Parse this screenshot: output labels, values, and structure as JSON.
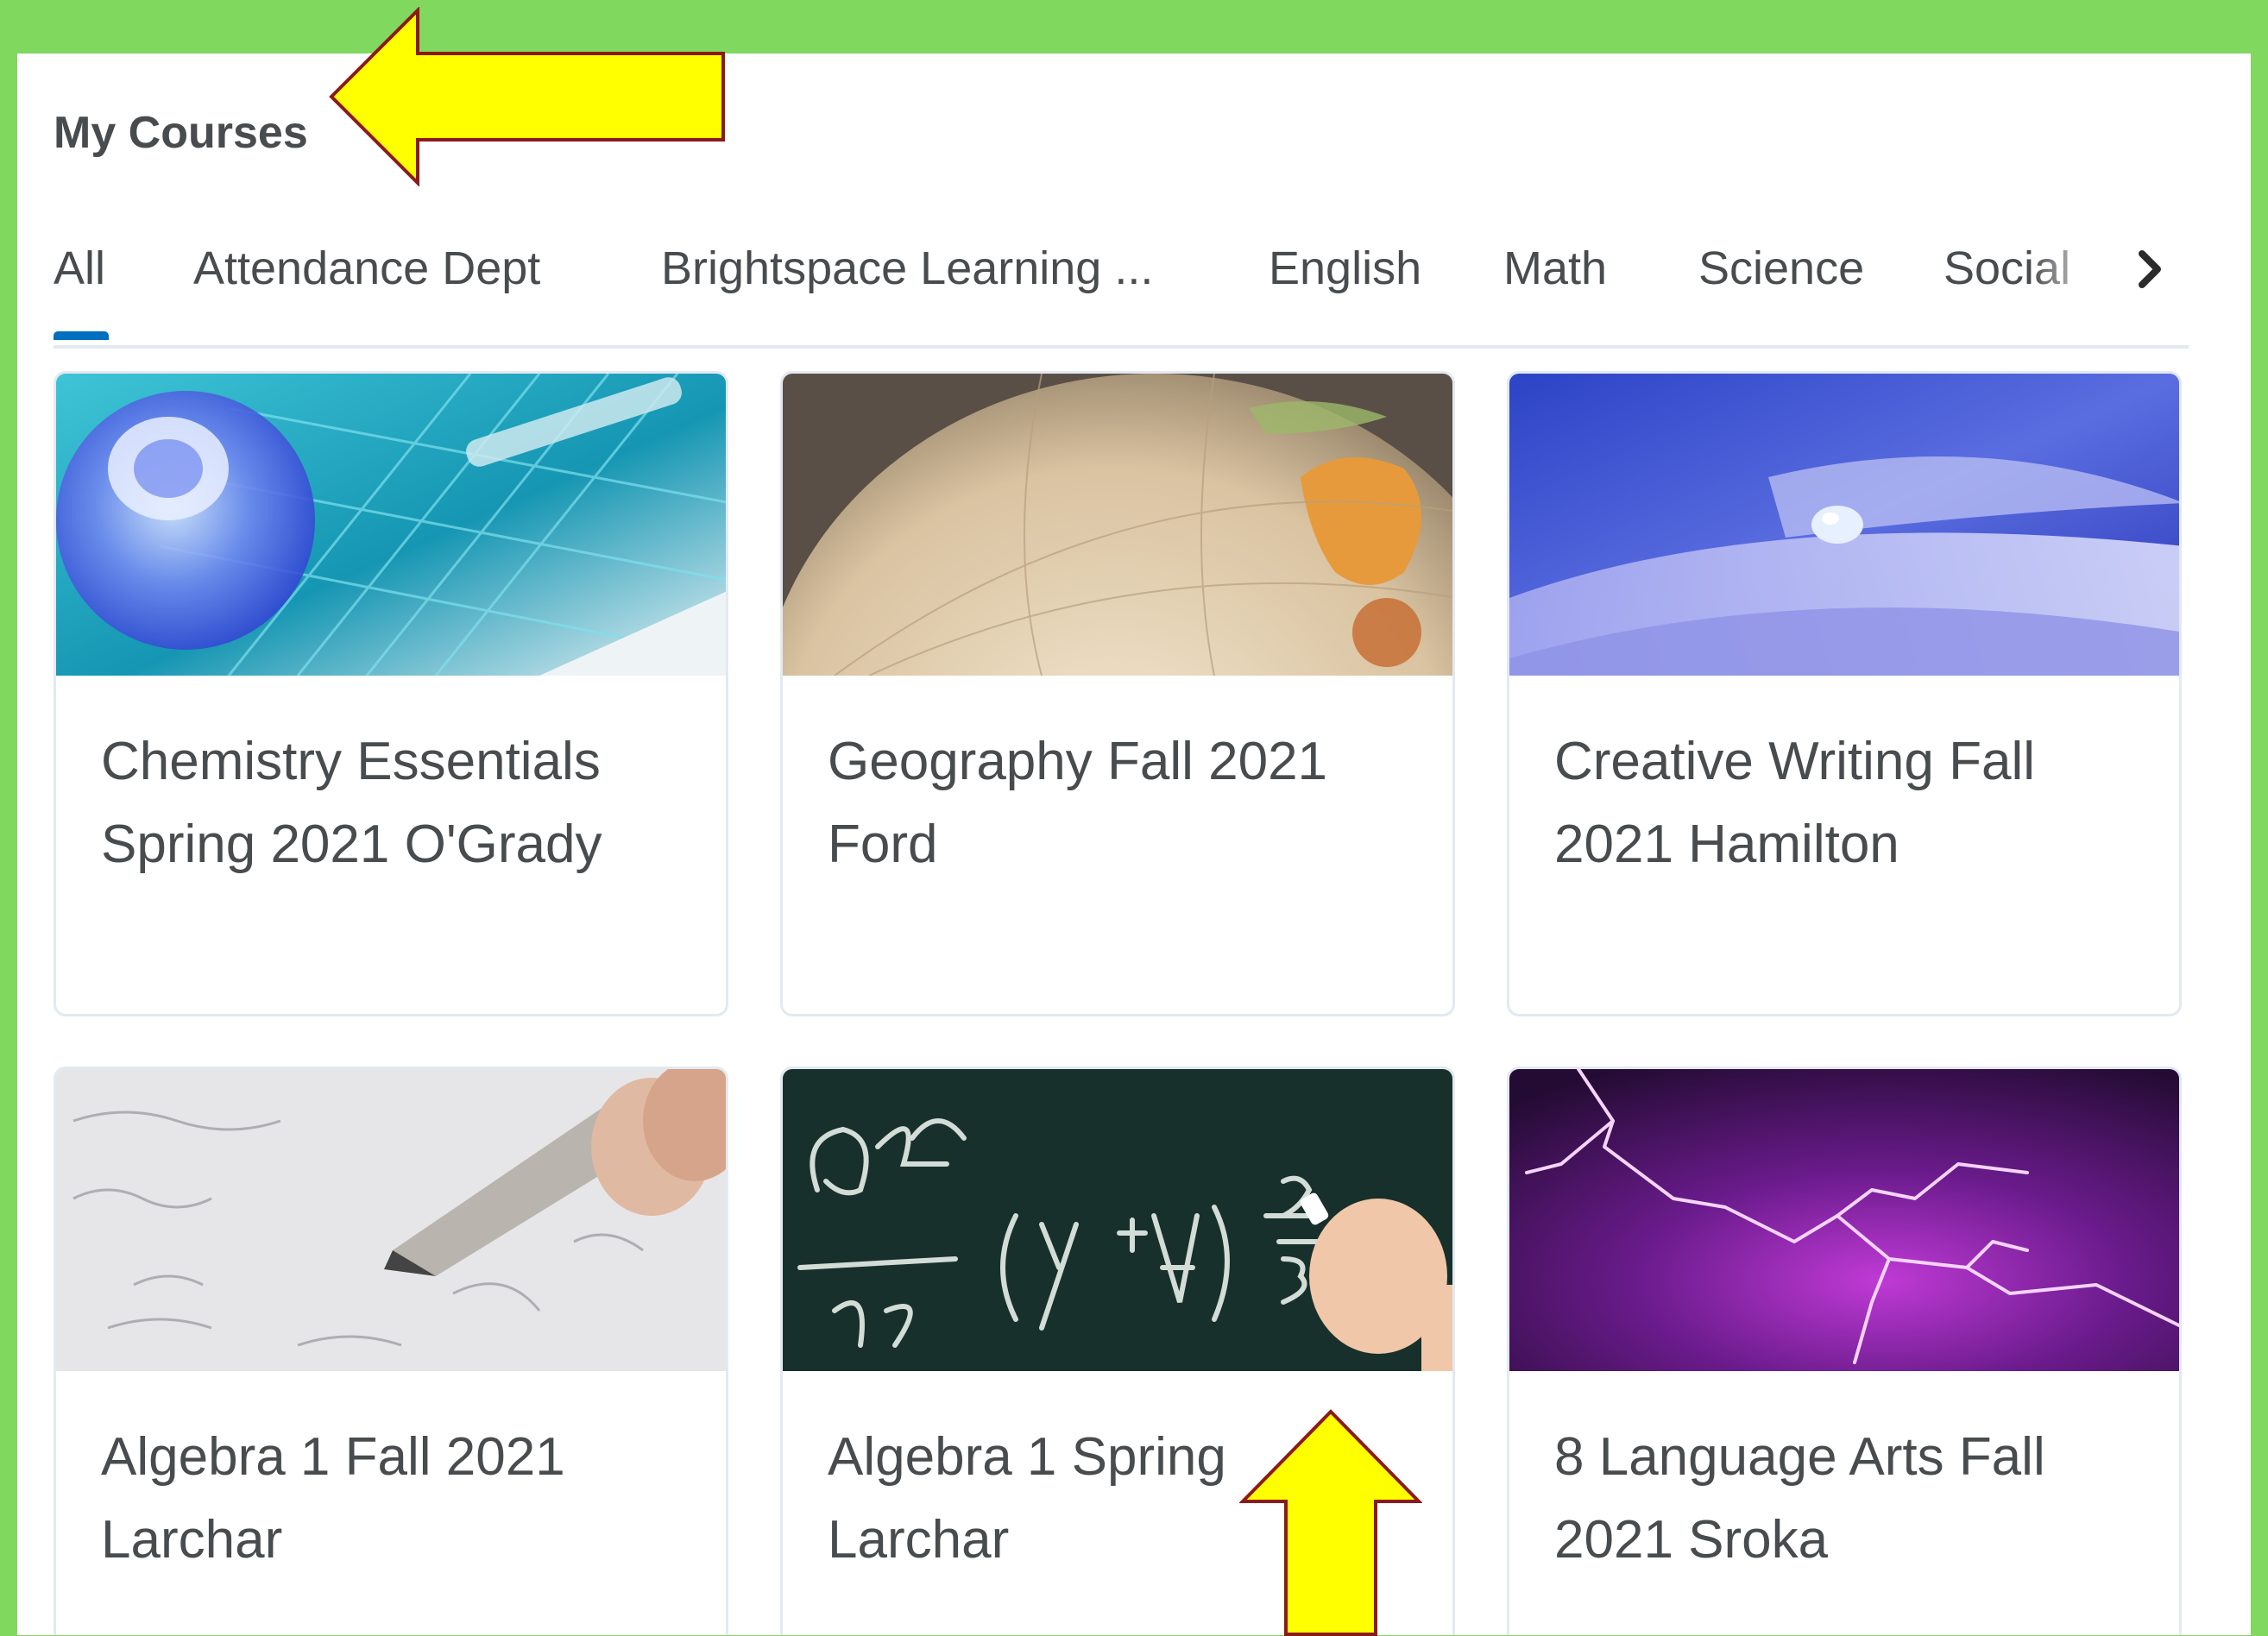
{
  "page": {
    "title": "My Courses"
  },
  "tabs": [
    {
      "label": "All",
      "selected": true
    },
    {
      "label": "Attendance Dept"
    },
    {
      "label": "Brightspace Learning ..."
    },
    {
      "label": "English"
    },
    {
      "label": "Math"
    },
    {
      "label": "Science"
    },
    {
      "label": "Social"
    }
  ],
  "courses": [
    {
      "title": "Chemistry Essentials Spring 2021 O'Grady",
      "image": "periodic-table-flask-image"
    },
    {
      "title": "Geography Fall 2021 Ford",
      "image": "globe-image"
    },
    {
      "title": "Creative Writing Fall 2021 Hamilton",
      "image": "water-droplet-petal-image"
    },
    {
      "title": "Algebra 1 Fall 2021 Larchar",
      "image": "pencil-math-paper-image"
    },
    {
      "title": "Algebra 1 Spring Larchar",
      "image": "chalkboard-equations-image"
    },
    {
      "title": "8 Language Arts Fall 2021 Sroka",
      "image": "purple-lightning-image"
    }
  ],
  "colors": {
    "frame_green": "#80d85e",
    "tab_accent": "#006fbf",
    "text": "#494c4e",
    "arrow_fill": "#ffff00",
    "arrow_stroke": "#8b1a1a"
  }
}
